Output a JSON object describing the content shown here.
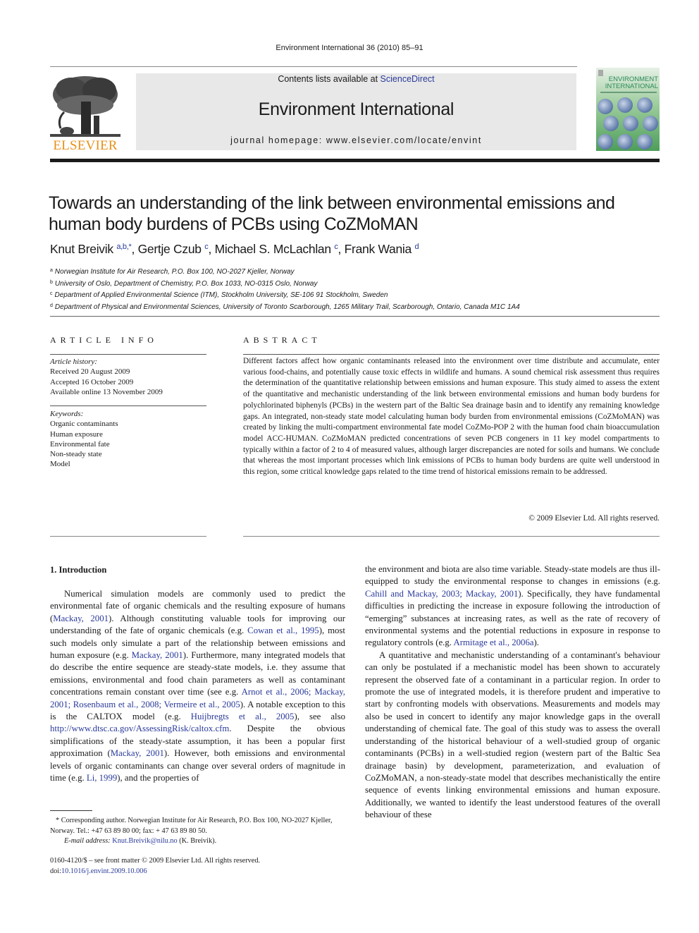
{
  "running_head": "Environment International 36 (2010) 85–91",
  "masthead": {
    "contents_prefix": "Contents lists available at ",
    "contents_link": "ScienceDirect",
    "journal_name": "Environment International",
    "homepage": "journal homepage: www.elsevier.com/locate/envint",
    "publisher": "ELSEVIER",
    "cover_title_line1": "ENVIRONMENT",
    "cover_title_line2": "INTERNATIONAL",
    "publisher_color": "#e8901a",
    "link_color": "#2a3a9a"
  },
  "article": {
    "title": "Towards an understanding of the link between environmental emissions and human body burdens of PCBs using CoZMoMAN",
    "authors": [
      {
        "name": "Knut Breivik",
        "sup": "a,b,*",
        "sep": ", "
      },
      {
        "name": "Gertje Czub",
        "sup": "c",
        "sep": ", "
      },
      {
        "name": "Michael S. McLachlan",
        "sup": "c",
        "sep": ", "
      },
      {
        "name": "Frank Wania",
        "sup": "d",
        "sep": ""
      }
    ],
    "affiliations": [
      {
        "key": "a",
        "text": "Norwegian Institute for Air Research, P.O. Box 100, NO-2027 Kjeller, Norway"
      },
      {
        "key": "b",
        "text": "University of Oslo, Department of Chemistry, P.O. Box 1033, NO-0315 Oslo, Norway"
      },
      {
        "key": "c",
        "text": "Department of Applied Environmental Science (ITM), Stockholm University, SE-106 91 Stockholm, Sweden"
      },
      {
        "key": "d",
        "text": "Department of Physical and Environmental Sciences, University of Toronto Scarborough, 1265 Military Trail, Scarborough, Ontario, Canada M1C 1A4"
      }
    ]
  },
  "article_info": {
    "heading": "ARTICLE INFO",
    "history_label": "Article history:",
    "history": [
      "Received 20 August 2009",
      "Accepted 16 October 2009",
      "Available online 13 November 2009"
    ],
    "keywords_label": "Keywords:",
    "keywords": [
      "Organic contaminants",
      "Human exposure",
      "Environmental fate",
      "Non-steady state",
      "Model"
    ]
  },
  "abstract": {
    "heading": "ABSTRACT",
    "text": "Different factors affect how organic contaminants released into the environment over time distribute and accumulate, enter various food-chains, and potentially cause toxic effects in wildlife and humans. A sound chemical risk assessment thus requires the determination of the quantitative relationship between emissions and human exposure. This study aimed to assess the extent of the quantitative and mechanistic understanding of the link between environmental emissions and human body burdens for polychlorinated biphenyls (PCBs) in the western part of the Baltic Sea drainage basin and to identify any remaining knowledge gaps. An integrated, non-steady state model calculating human body burden from environmental emissions (CoZMoMAN) was created by linking the multi-compartment environmental fate model CoZMo-POP 2 with the human food chain bioaccumulation model ACC-HUMAN. CoZMoMAN predicted concentrations of seven PCB congeners in 11 key model compartments to typically within a factor of 2 to 4 of measured values, although larger discrepancies are noted for soils and humans. We conclude that whereas the most important processes which link emissions of PCBs to human body burdens are quite well understood in this region, some critical knowledge gaps related to the time trend of historical emissions remain to be addressed.",
    "copyright": "© 2009 Elsevier Ltd. All rights reserved."
  },
  "intro": {
    "heading": "1. Introduction",
    "left_paragraph": [
      {
        "t": "Numerical simulation models are commonly used to predict the environmental fate of organic chemicals and the resulting exposure of humans ("
      },
      {
        "l": "Mackay, 2001"
      },
      {
        "t": "). Although constituting valuable tools for improving our understanding of the fate of organic chemicals (e.g. "
      },
      {
        "l": "Cowan et al., 1995"
      },
      {
        "t": "), most such models only simulate a part of the relationship between emissions and human exposure (e.g. "
      },
      {
        "l": "Mackay, 2001"
      },
      {
        "t": "). Furthermore, many integrated models that do describe the entire sequence are steady-state models, i.e. they assume that emissions, environmental and food chain parameters as well as contaminant concentrations remain constant over time (see e.g. "
      },
      {
        "l": "Arnot et al., 2006; Mackay, 2001; Rosenbaum et al., 2008; Vermeire et al., 2005"
      },
      {
        "t": "). A notable exception to this is the CALTOX model (e.g. "
      },
      {
        "l": "Huijbregts et al., 2005"
      },
      {
        "t": "), see also "
      },
      {
        "l": "http://www.dtsc.ca.gov/AssessingRisk/caltox.cfm"
      },
      {
        "t": ". Despite the obvious simplifications of the steady-state assumption, it has been a popular first approximation ("
      },
      {
        "l": "Mackay, 2001"
      },
      {
        "t": "). However, both emissions and environmental levels of organic contaminants can change over several orders of magnitude in time (e.g. "
      },
      {
        "l": "Li, 1999"
      },
      {
        "t": "), and the properties of"
      }
    ],
    "right_paragraph_1": [
      {
        "t": "the environment and biota are also time variable. Steady-state models are thus ill-equipped to study the environmental response to changes in emissions (e.g. "
      },
      {
        "l": "Cahill and Mackay, 2003; Mackay, 2001"
      },
      {
        "t": "). Specifically, they have fundamental difficulties in predicting the increase in exposure following the introduction of “emerging” substances at increasing rates, as well as the rate of recovery of environmental systems and the potential reductions in exposure in response to regulatory controls (e.g. "
      },
      {
        "l": "Armitage et al., 2006a"
      },
      {
        "t": ")."
      }
    ],
    "right_paragraph_2": [
      {
        "t": "A quantitative and mechanistic understanding of a contaminant's behaviour can only be postulated if a mechanistic model has been shown to accurately represent the observed fate of a contaminant in a particular region. In order to promote the use of integrated models, it is therefore prudent and imperative to start by confronting models with observations. Measurements and models may also be used in concert to identify any major knowledge gaps in the overall understanding of chemical fate. The goal of this study was to assess the overall understanding of the historical behaviour of a well-studied group of organic contaminants (PCBs) in a well-studied region (western part of the Baltic Sea drainage basin) by development, parameterization, and evaluation of CoZMoMAN, a non-steady-state model that describes mechanistically the entire sequence of events linking environmental emissions and human exposure. Additionally, we wanted to identify the least understood features of the overall behaviour of these"
      }
    ]
  },
  "footnote": {
    "corresponding": "* Corresponding author. Norwegian Institute for Air Research, P.O. Box 100, NO-2027 Kjeller, Norway. Tel.: +47 63 89 80 00; fax: + 47 63 89 80 50.",
    "email_label": "E-mail address: ",
    "email": "Knut.Breivik@nilu.no",
    "email_suffix": " (K. Breivik).",
    "issn": "0160-4120/$ – see front matter © 2009 Elsevier Ltd. All rights reserved.",
    "doi_prefix": "doi:",
    "doi": "10.1016/j.envint.2009.10.006"
  }
}
